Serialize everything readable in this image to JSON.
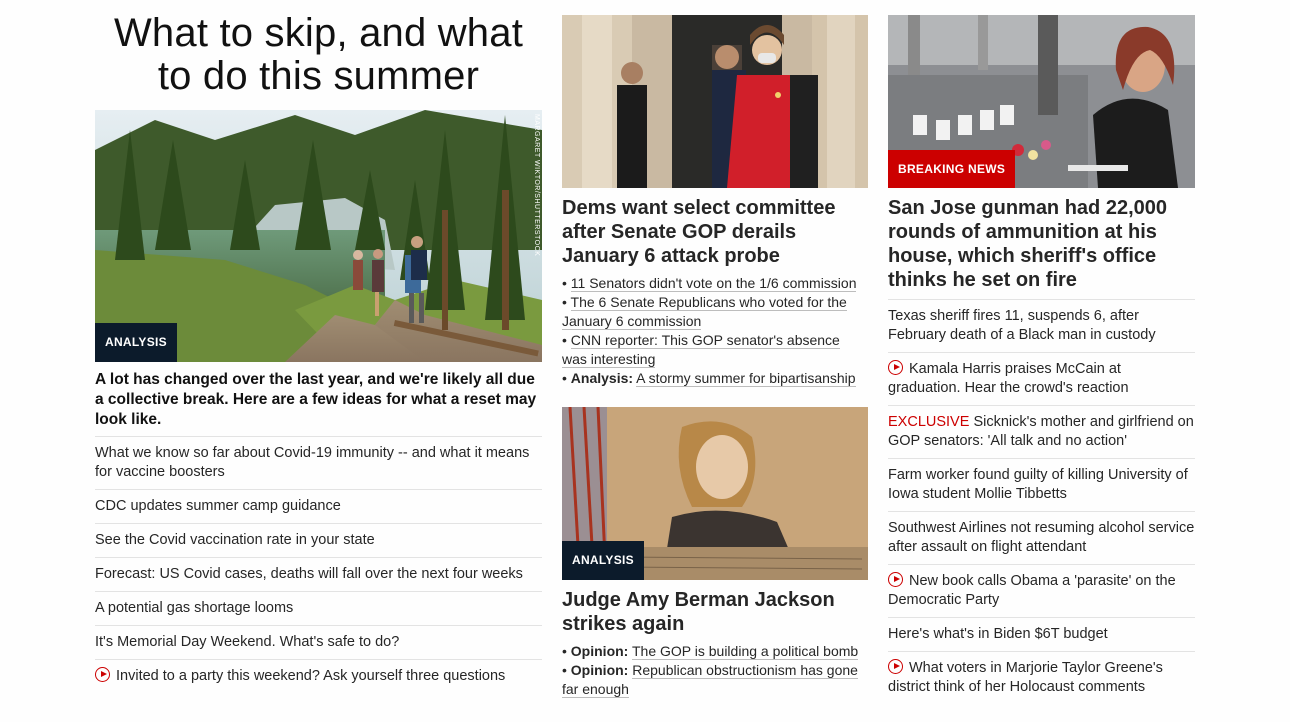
{
  "col1": {
    "title": "What to skip, and what to do this summer",
    "image": {
      "badge": "ANALYSIS",
      "credit": "MARGARET WIKTOR/SHUTTERSTOCK"
    },
    "lead": "A lot has changed over the last year, and we're likely all due a collective break. Here are a few ideas for what a reset may look like.",
    "items": [
      {
        "text": "What we know so far about Covid-19 immunity -- and what it means for vaccine boosters",
        "video": false
      },
      {
        "text": "CDC updates summer camp guidance",
        "video": false
      },
      {
        "text": "See the Covid vaccination rate in your state",
        "video": false
      },
      {
        "text": "Forecast: US Covid cases, deaths will fall over the next four weeks",
        "video": false
      },
      {
        "text": "A potential gas shortage looms",
        "video": false
      },
      {
        "text": "It's Memorial Day Weekend. What's safe to do?",
        "video": false
      },
      {
        "text": "Invited to a party this weekend? Ask yourself three questions",
        "video": true
      }
    ]
  },
  "col2": {
    "story1": {
      "headline": "Dems want select committee after Senate GOP derails January 6 attack probe",
      "bullets": [
        {
          "prefix": "",
          "text": "11 Senators didn't vote on the 1/6 commission"
        },
        {
          "prefix": "",
          "text": "The 6 Senate Republicans who voted for the January 6 commission"
        },
        {
          "prefix": "",
          "text": "CNN reporter: This GOP senator's absence was interesting"
        },
        {
          "prefix": "Analysis:",
          "text": "A stormy summer for bipartisanship"
        }
      ]
    },
    "story2": {
      "badge": "ANALYSIS",
      "headline": "Judge Amy Berman Jackson strikes again",
      "bullets": [
        {
          "prefix": "Opinion:",
          "text": "The GOP is building a political bomb"
        },
        {
          "prefix": "Opinion:",
          "text": "Republican obstructionism has gone far enough"
        }
      ]
    }
  },
  "col3": {
    "badge": "BREAKING NEWS",
    "headline": "San Jose gunman had 22,000 rounds of ammunition at his house, which sheriff's office thinks he set on fire",
    "items": [
      {
        "text": "Texas sheriff fires 11, suspends 6, after February death of a Black man in custody",
        "video": false,
        "tag": ""
      },
      {
        "text": "Kamala Harris praises McCain at graduation. Hear the crowd's reaction",
        "video": true,
        "tag": ""
      },
      {
        "text": "Sicknick's mother and girlfriend on GOP senators: 'All talk and no action'",
        "video": false,
        "tag": "EXCLUSIVE"
      },
      {
        "text": "Farm worker found guilty of killing University of Iowa student Mollie Tibbetts",
        "video": false,
        "tag": ""
      },
      {
        "text": "Southwest Airlines not resuming alcohol service after assault on flight attendant",
        "video": false,
        "tag": ""
      },
      {
        "text": "New book calls Obama a 'parasite' on the Democratic Party",
        "video": true,
        "tag": ""
      },
      {
        "text": "Here's what's in Biden $6T budget",
        "video": false,
        "tag": ""
      },
      {
        "text": "What voters in Marjorie Taylor Greene's district think of her Holocaust comments",
        "video": true,
        "tag": ""
      }
    ]
  }
}
